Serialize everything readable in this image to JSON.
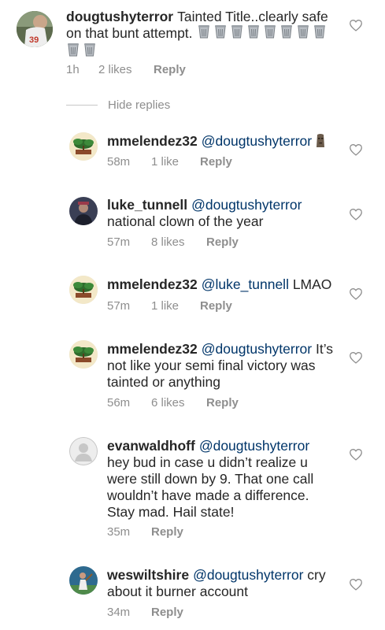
{
  "comments": [
    {
      "username": "dougtushyterror",
      "text": "Tainted Title..clearly safe on that bunt attempt.",
      "time": "1h",
      "likes": "2 likes",
      "reply": "Reply",
      "avatar": "baseball-player-jersey-icon"
    }
  ],
  "hide_replies": "Hide replies",
  "replies": [
    {
      "username": "mmelendez32",
      "mention": "@dougtushyterror",
      "text": "",
      "time": "58m",
      "likes": "1 like",
      "reply": "Reply",
      "avatar": "bonsai-logo-icon"
    },
    {
      "username": "luke_tunnell",
      "mention": "@dougtushyterror",
      "text": "national clown of the year",
      "time": "57m",
      "likes": "8 likes",
      "reply": "Reply",
      "avatar": "person-photo-icon"
    },
    {
      "username": "mmelendez32",
      "mention": "@luke_tunnell",
      "text": "LMAO",
      "time": "57m",
      "likes": "1 like",
      "reply": "Reply",
      "avatar": "bonsai-logo-icon"
    },
    {
      "username": "mmelendez32",
      "mention": "@dougtushyterror",
      "text": "It’s not like your semi final victory was tainted or anything",
      "time": "56m",
      "likes": "6 likes",
      "reply": "Reply",
      "avatar": "bonsai-logo-icon"
    },
    {
      "username": "evanwaldhoff",
      "mention": "@dougtushyterror",
      "text": "hey bud in case u didn’t realize u were still down by 9. That one call wouldn’t have made a difference. Stay mad. Hail state!",
      "time": "35m",
      "likes": "",
      "reply": "Reply",
      "avatar": "default-profile-icon"
    },
    {
      "username": "weswiltshire",
      "mention": "@dougtushyterror",
      "text": "cry about it burner account",
      "time": "34m",
      "likes": "",
      "reply": "Reply",
      "avatar": "baseball-action-photo-icon"
    }
  ],
  "colors": {
    "text": "#262626",
    "meta": "#8e8e8e",
    "mention": "#003569",
    "divider": "#c7c7c7"
  }
}
